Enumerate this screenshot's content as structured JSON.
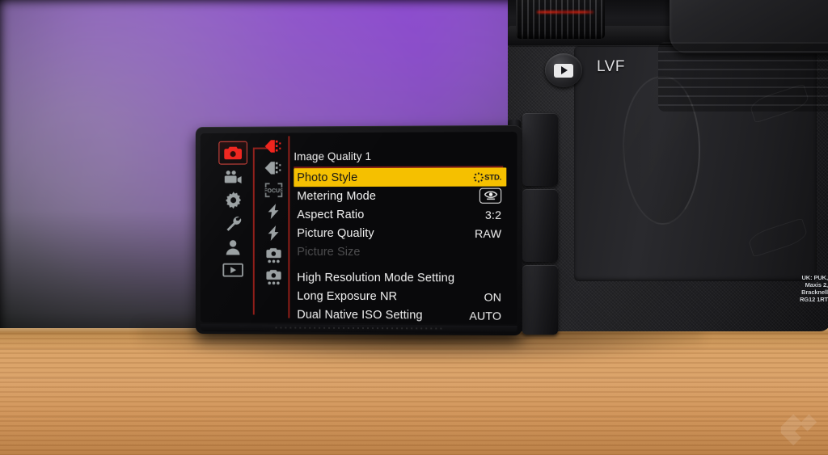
{
  "scene": {
    "description": "Camera rear LCD displaying Panasonic-style photo menu on a wooden table",
    "colors": {
      "highlight_yellow": "#f5c000",
      "menu_red": "#f0211a",
      "rail_red": "#8f1d18",
      "icon_gray": "#9aa0a2",
      "disabled_gray": "#4d4d4f",
      "screen_black": "#09090b",
      "wood_tan": "#d9a067",
      "bokeh_purple": "#9a48f0",
      "bokeh_green": "#16251c"
    }
  },
  "camera": {
    "playback_button": "play-icon",
    "lvf_label": "LVF",
    "regulatory_text_lines": [
      "UK: PUK,",
      "Maxis 2,",
      "Bracknell",
      "RG12 1RT"
    ],
    "watermark": "logo-watermark"
  },
  "menu": {
    "header": "Image Quality 1",
    "main_tabs": [
      {
        "name": "tab-photo",
        "icon": "camera-icon",
        "active": true
      },
      {
        "name": "tab-video",
        "icon": "movie-icon",
        "active": false
      },
      {
        "name": "tab-custom",
        "icon": "gear-icon",
        "active": false
      },
      {
        "name": "tab-setup",
        "icon": "wrench-icon",
        "active": false
      },
      {
        "name": "tab-my-menu",
        "icon": "person-icon",
        "active": false
      },
      {
        "name": "tab-playback",
        "icon": "playback-icon",
        "active": false
      }
    ],
    "sub_tabs": [
      {
        "name": "subtab-image-quality-1",
        "icon": "quality-icon",
        "active": true
      },
      {
        "name": "subtab-image-quality-2",
        "icon": "quality-icon",
        "active": false
      },
      {
        "name": "subtab-focus",
        "icon": "focus-frame-icon",
        "active": false
      },
      {
        "name": "subtab-flash-1",
        "icon": "flash-bolt-icon",
        "active": false
      },
      {
        "name": "subtab-flash-2",
        "icon": "flash-bolt-icon",
        "active": false
      },
      {
        "name": "subtab-others-1",
        "icon": "camera-dots-icon",
        "active": false
      },
      {
        "name": "subtab-others-2",
        "icon": "camera-dots-icon",
        "active": false
      }
    ],
    "rows": [
      {
        "label": "Photo Style",
        "value": "STD.",
        "value_type": "photo-style-badge",
        "selected": true,
        "disabled": false
      },
      {
        "label": "Metering Mode",
        "value": "",
        "value_type": "metering-icon",
        "selected": false,
        "disabled": false
      },
      {
        "label": "Aspect Ratio",
        "value": "3:2",
        "value_type": "text",
        "selected": false,
        "disabled": false
      },
      {
        "label": "Picture Quality",
        "value": "RAW",
        "value_type": "text",
        "selected": false,
        "disabled": false
      },
      {
        "label": "Picture Size",
        "value": "",
        "value_type": "text",
        "selected": false,
        "disabled": true
      },
      {
        "label": "High Resolution Mode Setting",
        "value": "",
        "value_type": "text",
        "selected": false,
        "disabled": false
      },
      {
        "label": "Long Exposure NR",
        "value": "ON",
        "value_type": "text",
        "selected": false,
        "disabled": false
      },
      {
        "label": "Dual Native ISO Setting",
        "value": "AUTO",
        "value_type": "text",
        "selected": false,
        "disabled": false
      }
    ]
  }
}
